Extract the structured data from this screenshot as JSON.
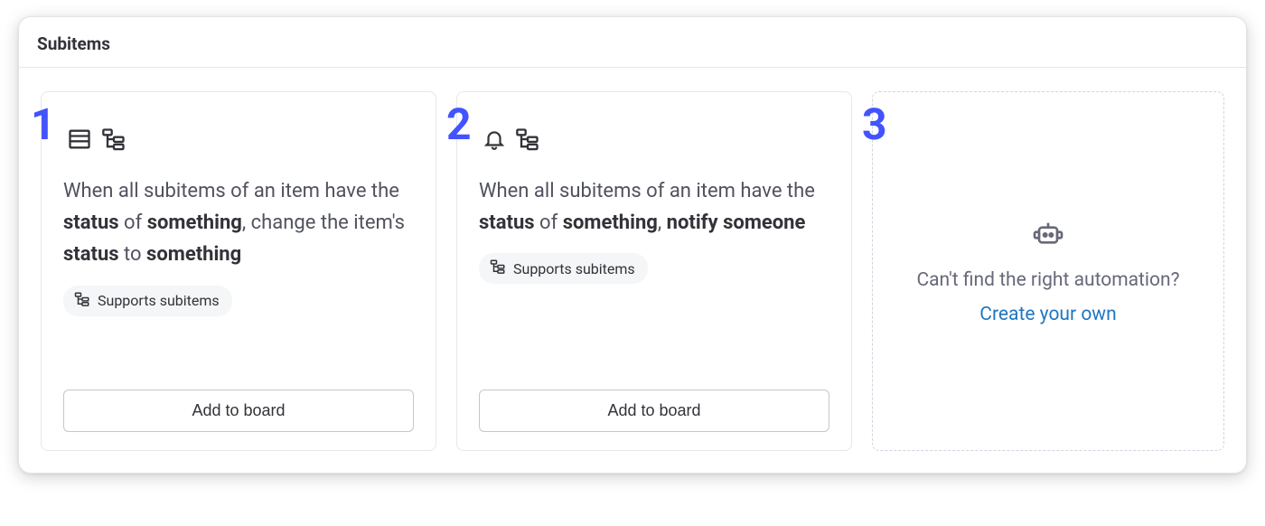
{
  "section": {
    "title": "Subitems"
  },
  "cards": [
    {
      "index": "1",
      "text_prefix": "When all subitems of an item have the ",
      "bold1": "status",
      "mid1": " of ",
      "bold2": "something",
      "mid2": ", change the item's ",
      "bold3": "status",
      "mid3": " to ",
      "bold4": "something",
      "supports_label": "Supports subitems",
      "add_label": "Add to board"
    },
    {
      "index": "2",
      "text_prefix": "When all subitems of an item have the ",
      "bold1": "status",
      "mid1": " of ",
      "bold2": "something",
      "mid2": ", ",
      "bold3": "notify",
      "mid3": " ",
      "bold4": "someone",
      "supports_label": "Supports subitems",
      "add_label": "Add to board"
    }
  ],
  "create": {
    "index": "3",
    "question": "Can't find the right automation?",
    "link": "Create your own"
  }
}
